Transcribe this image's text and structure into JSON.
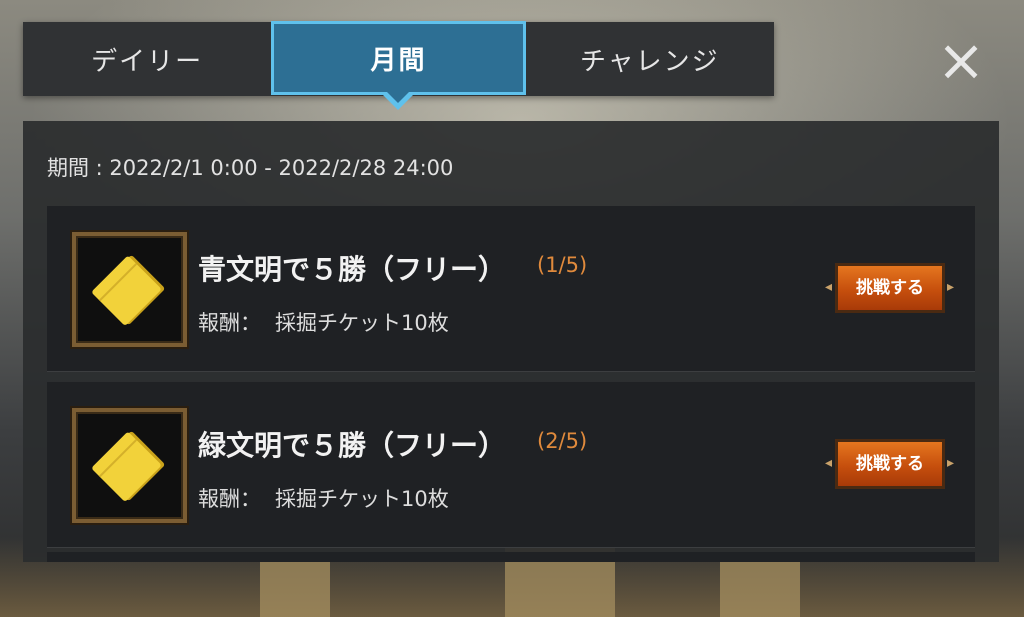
{
  "tabs": [
    {
      "label": "デイリー",
      "active": false
    },
    {
      "label": "月間",
      "active": true
    },
    {
      "label": "チャレンジ",
      "active": false
    }
  ],
  "close_icon": "close-icon",
  "period_text": "期間 : 2022/2/1 0:00 - 2022/2/28 24:00",
  "missions": [
    {
      "title": "青文明で５勝（フリー）",
      "progress": "(1/5)",
      "reward_label": "報酬：",
      "reward_value": "採掘チケット10枚",
      "button_label": "挑戦する",
      "icon": "ticket-icon"
    },
    {
      "title": "緑文明で５勝（フリー）",
      "progress": "(2/5)",
      "reward_label": "報酬：",
      "reward_value": "採掘チケット10枚",
      "button_label": "挑戦する",
      "icon": "ticket-icon"
    }
  ],
  "colors": {
    "tab_active_bg": "#2d6f94",
    "tab_active_border": "#5fc1ec",
    "progress": "#e08a3c",
    "button": "#d8621a"
  }
}
